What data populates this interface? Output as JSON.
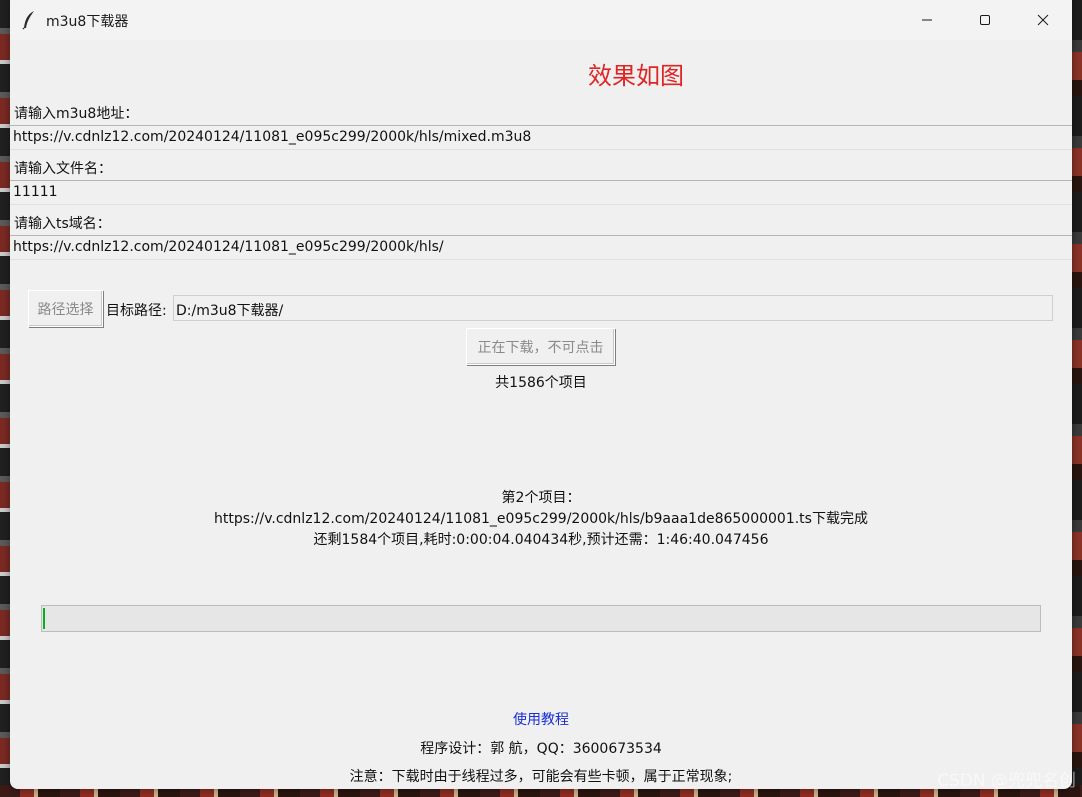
{
  "window": {
    "title": "m3u8下载器"
  },
  "headline": "效果如图",
  "form": {
    "m3u8_label": "请输入m3u8地址：",
    "m3u8_value": "https://v.cdnlz12.com/20240124/11081_e095c299/2000k/hls/mixed.m3u8",
    "filename_label": "请输入文件名：",
    "filename_value": "11111",
    "ts_label": "请输入ts域名：",
    "ts_value": "https://v.cdnlz12.com/20240124/11081_e095c299/2000k/hls/"
  },
  "path": {
    "button_label": "路径选择",
    "label": "目标路径:",
    "value": "D:/m3u8下载器/"
  },
  "download": {
    "button_label": "正在下载，不可点击",
    "total_text": "共1586个项目"
  },
  "status": {
    "line1": "第2个项目：",
    "line2": "https://v.cdnlz12.com/20240124/11081_e095c299/2000k/hls/b9aaa1de865000001.ts下载完成",
    "line3": "还剩1584个项目,耗时:0:00:04.040434秒,预计还需：1:46:40.047456"
  },
  "progress": {
    "fraction": 0.0013,
    "color": "#06b025"
  },
  "footer": {
    "tutorial_link": "使用教程",
    "credit": "程序设计：郭 航，QQ：3600673534",
    "notice": "注意：下载时由于线程过多，可能会有些卡顿，属于正常现象;"
  },
  "watermark": "CSDN @兜兜名创",
  "colors": {
    "headline": "#e02424",
    "link": "#1a2fd4"
  },
  "icons": [
    "feather-icon",
    "minimize-icon",
    "maximize-icon",
    "close-icon"
  ]
}
